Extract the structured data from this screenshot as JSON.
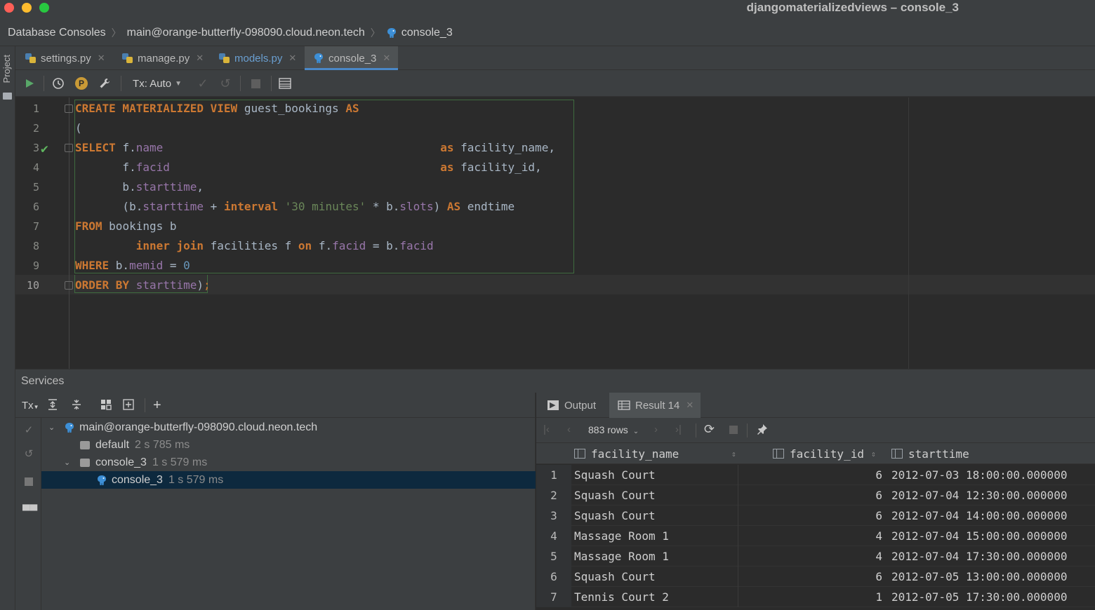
{
  "window": {
    "title": "djangomaterializedviews – console_3"
  },
  "breadcrumb": {
    "items": [
      "Database Consoles",
      "main@orange-butterfly-098090.cloud.neon.tech",
      "console_3"
    ]
  },
  "left_strip": {
    "project_label": "Project"
  },
  "tabs": [
    {
      "label": "settings.py",
      "active": false
    },
    {
      "label": "manage.py",
      "active": false
    },
    {
      "label": "models.py",
      "active": false
    },
    {
      "label": "console_3",
      "active": true
    }
  ],
  "toolbar": {
    "tx_mode": "Tx: Auto",
    "p_badge": "P"
  },
  "editor": {
    "line_numbers": [
      "1",
      "2",
      "3",
      "4",
      "5",
      "6",
      "7",
      "8",
      "9",
      "10"
    ]
  },
  "services": {
    "title": "Services",
    "tx_label": "Tx",
    "tree": [
      {
        "label": "main@orange-butterfly-098090.cloud.neon.tech",
        "time": ""
      },
      {
        "label": "default",
        "time": "2 s 785 ms"
      },
      {
        "label": "console_3",
        "time": "1 s 579 ms"
      },
      {
        "label": "console_3",
        "time": "1 s 579 ms"
      }
    ]
  },
  "results": {
    "tabs": {
      "output": "Output",
      "result": "Result 14"
    },
    "rows_label": "883 rows",
    "columns": [
      "facility_name",
      "facility_id",
      "starttime"
    ],
    "rows": [
      {
        "n": "1",
        "facility_name": "Squash Court",
        "facility_id": "6",
        "starttime": "2012-07-03 18:00:00.000000"
      },
      {
        "n": "2",
        "facility_name": "Squash Court",
        "facility_id": "6",
        "starttime": "2012-07-04 12:30:00.000000"
      },
      {
        "n": "3",
        "facility_name": "Squash Court",
        "facility_id": "6",
        "starttime": "2012-07-04 14:00:00.000000"
      },
      {
        "n": "4",
        "facility_name": "Massage Room 1",
        "facility_id": "4",
        "starttime": "2012-07-04 15:00:00.000000"
      },
      {
        "n": "5",
        "facility_name": "Massage Room 1",
        "facility_id": "4",
        "starttime": "2012-07-04 17:30:00.000000"
      },
      {
        "n": "6",
        "facility_name": "Squash Court",
        "facility_id": "6",
        "starttime": "2012-07-05 13:00:00.000000"
      },
      {
        "n": "7",
        "facility_name": "Tennis Court 2",
        "facility_id": "1",
        "starttime": "2012-07-05 17:30:00.000000"
      }
    ]
  },
  "colors": {
    "accent": "#4a88c7",
    "keyword": "#cc7832",
    "field": "#9876aa",
    "string": "#6a8759",
    "number": "#6897bb",
    "selection": "#0d293e"
  },
  "icons": [
    "run-icon",
    "history-icon",
    "settings-wrench-icon",
    "commit-icon",
    "rollback-icon",
    "stop-icon",
    "table-icon",
    "postgres-elephant-icon",
    "python-file-icon",
    "pin-icon",
    "refresh-icon"
  ]
}
